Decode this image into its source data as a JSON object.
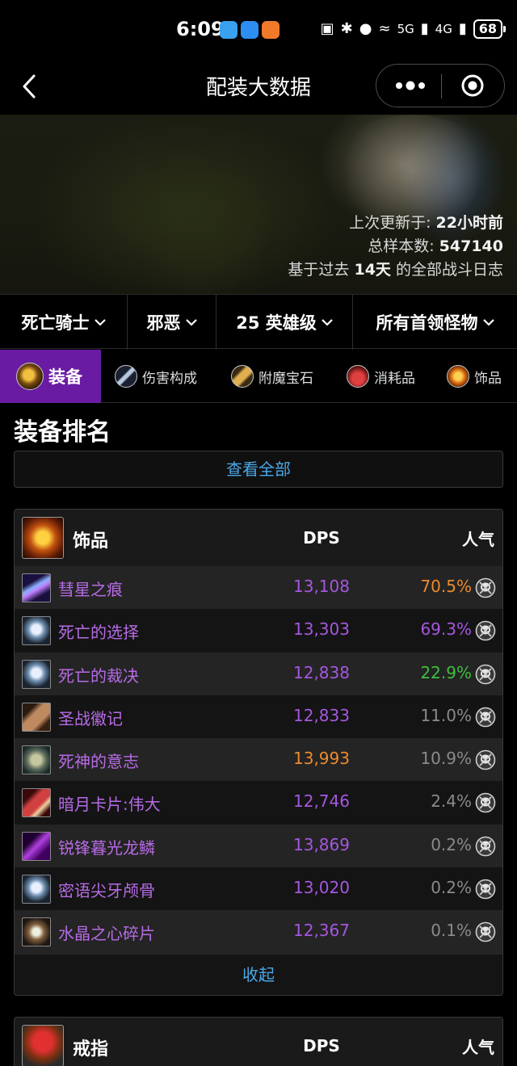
{
  "status_bar": {
    "time": "6:09",
    "net_5g": "5G",
    "net_4g": "4G",
    "battery": "68"
  },
  "nav": {
    "title": "配装大数据"
  },
  "banner": {
    "updated_label": "上次更新于:",
    "updated_value": "22小时前",
    "samples_label": "总样本数:",
    "samples_value": "547140",
    "basis_prefix": "基于过去",
    "basis_value": "14天",
    "basis_suffix": "的全部战斗日志"
  },
  "filters": [
    {
      "label": "死亡骑士"
    },
    {
      "label": "邪恶"
    },
    {
      "label": "25 英雄级"
    },
    {
      "label": "所有首领怪物"
    }
  ],
  "tabs": [
    {
      "label": "装备",
      "icon": "gear-orb-icon"
    },
    {
      "label": "伤害构成",
      "icon": "sword-icon"
    },
    {
      "label": "附魔宝石",
      "icon": "scroll-icon"
    },
    {
      "label": "消耗品",
      "icon": "potion-icon"
    },
    {
      "label": "饰品",
      "icon": "trinket-icon"
    }
  ],
  "section": {
    "title": "装备排名",
    "view_all": "查看全部"
  },
  "trinket_table": {
    "title": "饰品",
    "col_dps": "DPS",
    "col_popularity": "人气",
    "collapse": "收起",
    "rows": [
      {
        "name": "彗星之痕",
        "dps": "13,108",
        "popularity": "70.5%",
        "dps_color": "#a657e0",
        "pop_color": "#ee8a2c",
        "icon": "comet-icon"
      },
      {
        "name": "死亡的选择",
        "dps": "13,303",
        "popularity": "69.3%",
        "dps_color": "#a657e0",
        "pop_color": "#a657e0",
        "icon": "skull-icon"
      },
      {
        "name": "死亡的裁决",
        "dps": "12,838",
        "popularity": "22.9%",
        "dps_color": "#a657e0",
        "pop_color": "#3fbf3f",
        "icon": "skull-icon"
      },
      {
        "name": "圣战徽记",
        "dps": "12,833",
        "popularity": "11.0%",
        "dps_color": "#a657e0",
        "pop_color": "#8a8a8a",
        "icon": "sigil-icon"
      },
      {
        "name": "死神的意志",
        "dps": "13,993",
        "popularity": "10.9%",
        "dps_color": "#ee8a2c",
        "pop_color": "#8a8a8a",
        "icon": "relic-icon"
      },
      {
        "name": "暗月卡片:伟大",
        "dps": "12,746",
        "popularity": "2.4%",
        "dps_color": "#a657e0",
        "pop_color": "#8a8a8a",
        "icon": "card-icon"
      },
      {
        "name": "锐锋暮光龙鳞",
        "dps": "13,869",
        "popularity": "0.2%",
        "dps_color": "#a657e0",
        "pop_color": "#8a8a8a",
        "icon": "scale-icon"
      },
      {
        "name": "密语尖牙颅骨",
        "dps": "13,020",
        "popularity": "0.2%",
        "dps_color": "#a657e0",
        "pop_color": "#8a8a8a",
        "icon": "skull-icon"
      },
      {
        "name": "水晶之心碎片",
        "dps": "12,367",
        "popularity": "0.1%",
        "dps_color": "#a657e0",
        "pop_color": "#8a8a8a",
        "icon": "crystal-icon"
      }
    ]
  },
  "ring_table": {
    "title": "戒指",
    "col_dps": "DPS",
    "col_popularity": "人气"
  },
  "colors": {
    "accent_purple": "#6a1ba3",
    "link_blue": "#4aa8e8",
    "epic_purple": "#a657e0",
    "legendary_orange": "#ee8a2c",
    "uncommon_green": "#3fbf3f"
  }
}
